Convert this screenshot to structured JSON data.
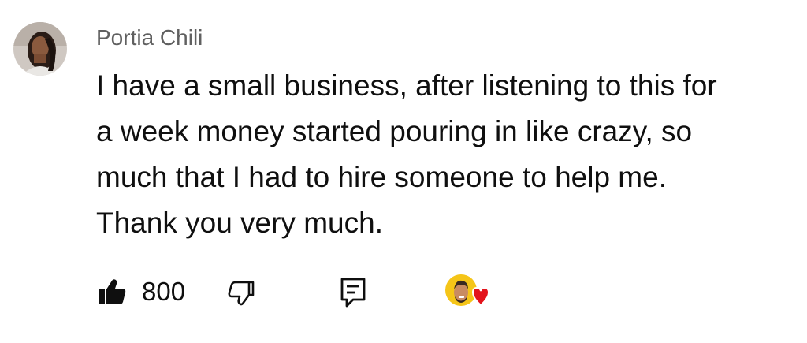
{
  "comment": {
    "author": "Portia Chili",
    "text_lines": [
      "I have a small business, after listening to this for",
      "a week money started pouring in like crazy, so",
      "much that I had to hire someone to help me.",
      "Thank you very much."
    ],
    "like_count": "800",
    "icons": {
      "avatar": "user-avatar",
      "like": "thumbs-up-filled-icon",
      "dislike": "thumbs-down-outline-icon",
      "reply": "reply-comment-icon",
      "creator_heart": "creator-heart-badge"
    },
    "colors": {
      "author": "#606060",
      "text": "#0f0f0f",
      "heart": "#ff0000",
      "badge_bg": "#f5c518"
    }
  }
}
